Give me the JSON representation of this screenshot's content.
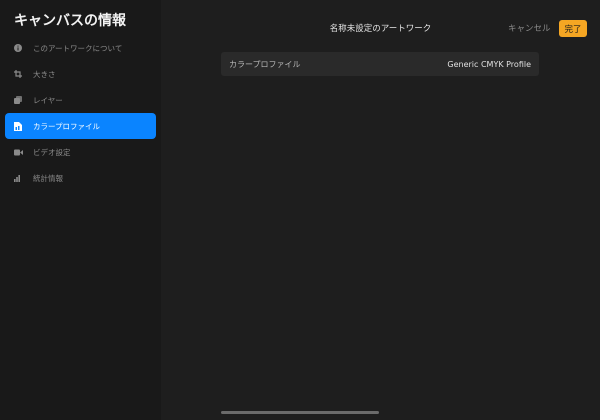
{
  "sidebar": {
    "title": "キャンバスの情報",
    "items": [
      {
        "label": "このアートワークについて",
        "icon": "info-icon",
        "active": false
      },
      {
        "label": "大きさ",
        "icon": "crop-icon",
        "active": false
      },
      {
        "label": "レイヤー",
        "icon": "layers-icon",
        "active": false
      },
      {
        "label": "カラープロファイル",
        "icon": "color-profile-icon",
        "active": true
      },
      {
        "label": "ビデオ設定",
        "icon": "video-camera-icon",
        "active": false
      },
      {
        "label": "統計情報",
        "icon": "bar-chart-icon",
        "active": false
      }
    ]
  },
  "header": {
    "title": "名称未設定のアートワーク",
    "cancel_label": "キャンセル",
    "done_label": "完了"
  },
  "color_profile": {
    "label": "カラープロファイル",
    "value": "Generic CMYK Profile"
  },
  "colors": {
    "accent": "#0a84ff",
    "done_button": "#f5a623",
    "background": "#1e1e1e",
    "sidebar": "#191919"
  }
}
